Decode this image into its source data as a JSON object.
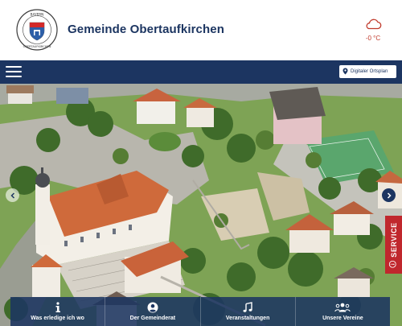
{
  "header": {
    "title": "Gemeinde Obertaufkirchen",
    "crest_text": "BAYERN · OBERTAUFKIRCHEN",
    "weather": {
      "icon": "cloud-icon",
      "temperature": "-0 °C"
    }
  },
  "nav": {
    "menu_icon": "hamburger-icon",
    "ortsplan_label": "Digitaler Ortsplan",
    "ortsplan_icon": "map-pin-icon"
  },
  "hero": {
    "prev_icon": "chevron-left-icon",
    "next_icon": "chevron-right-icon"
  },
  "service_tab": {
    "label": "SERVICE",
    "icon": "info-icon"
  },
  "quick_links": [
    {
      "label": "Was erledige ich wo",
      "icon": "info-icon"
    },
    {
      "label": "Der Gemeinderat",
      "icon": "user-icon"
    },
    {
      "label": "Veranstaltungen",
      "icon": "music-note-icon"
    },
    {
      "label": "Unsere Vereine",
      "icon": "group-icon"
    }
  ],
  "colors": {
    "primary": "#1c3561",
    "accent": "#c0272d",
    "background": "#ffffff"
  }
}
